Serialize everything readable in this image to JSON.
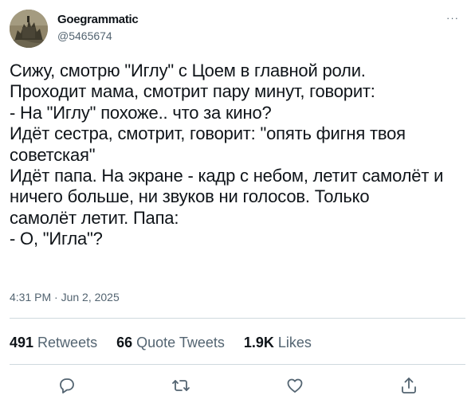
{
  "author": {
    "display_name": "Goegrammatic",
    "handle": "@5465674",
    "avatar_icon": "castle-painting-avatar"
  },
  "tweet": {
    "lines": [
      "Сижу, смотрю \"Иглу\" с Цоем в главной роли.",
      "Проходит мама, смотрит пару минут, говорит:",
      "- На \"Иглу\" похоже.. что за кино?",
      "Идёт сестра, смотрит, говорит: \"опять фигня твоя",
      "советская\"",
      "Идёт папа. На экране - кадр с небом, летит самолёт и",
      "ничего больше, ни звуков ни голосов. Только",
      "самолёт летит. Папа:",
      "- О, \"Игла\"?"
    ],
    "timestamp": "4:31 PM · Jun 2, 2025"
  },
  "stats": {
    "retweets_count": "491",
    "retweets_label": "Retweets",
    "quotes_count": "66",
    "quotes_label": "Quote Tweets",
    "likes_count": "1.9K",
    "likes_label": "Likes"
  },
  "more_label": "···",
  "actions": [
    "reply-icon",
    "retweet-icon",
    "like-icon",
    "share-icon"
  ],
  "colors": {
    "text": "#0f1419",
    "secondary": "#536471",
    "divider": "#cfd9de"
  }
}
